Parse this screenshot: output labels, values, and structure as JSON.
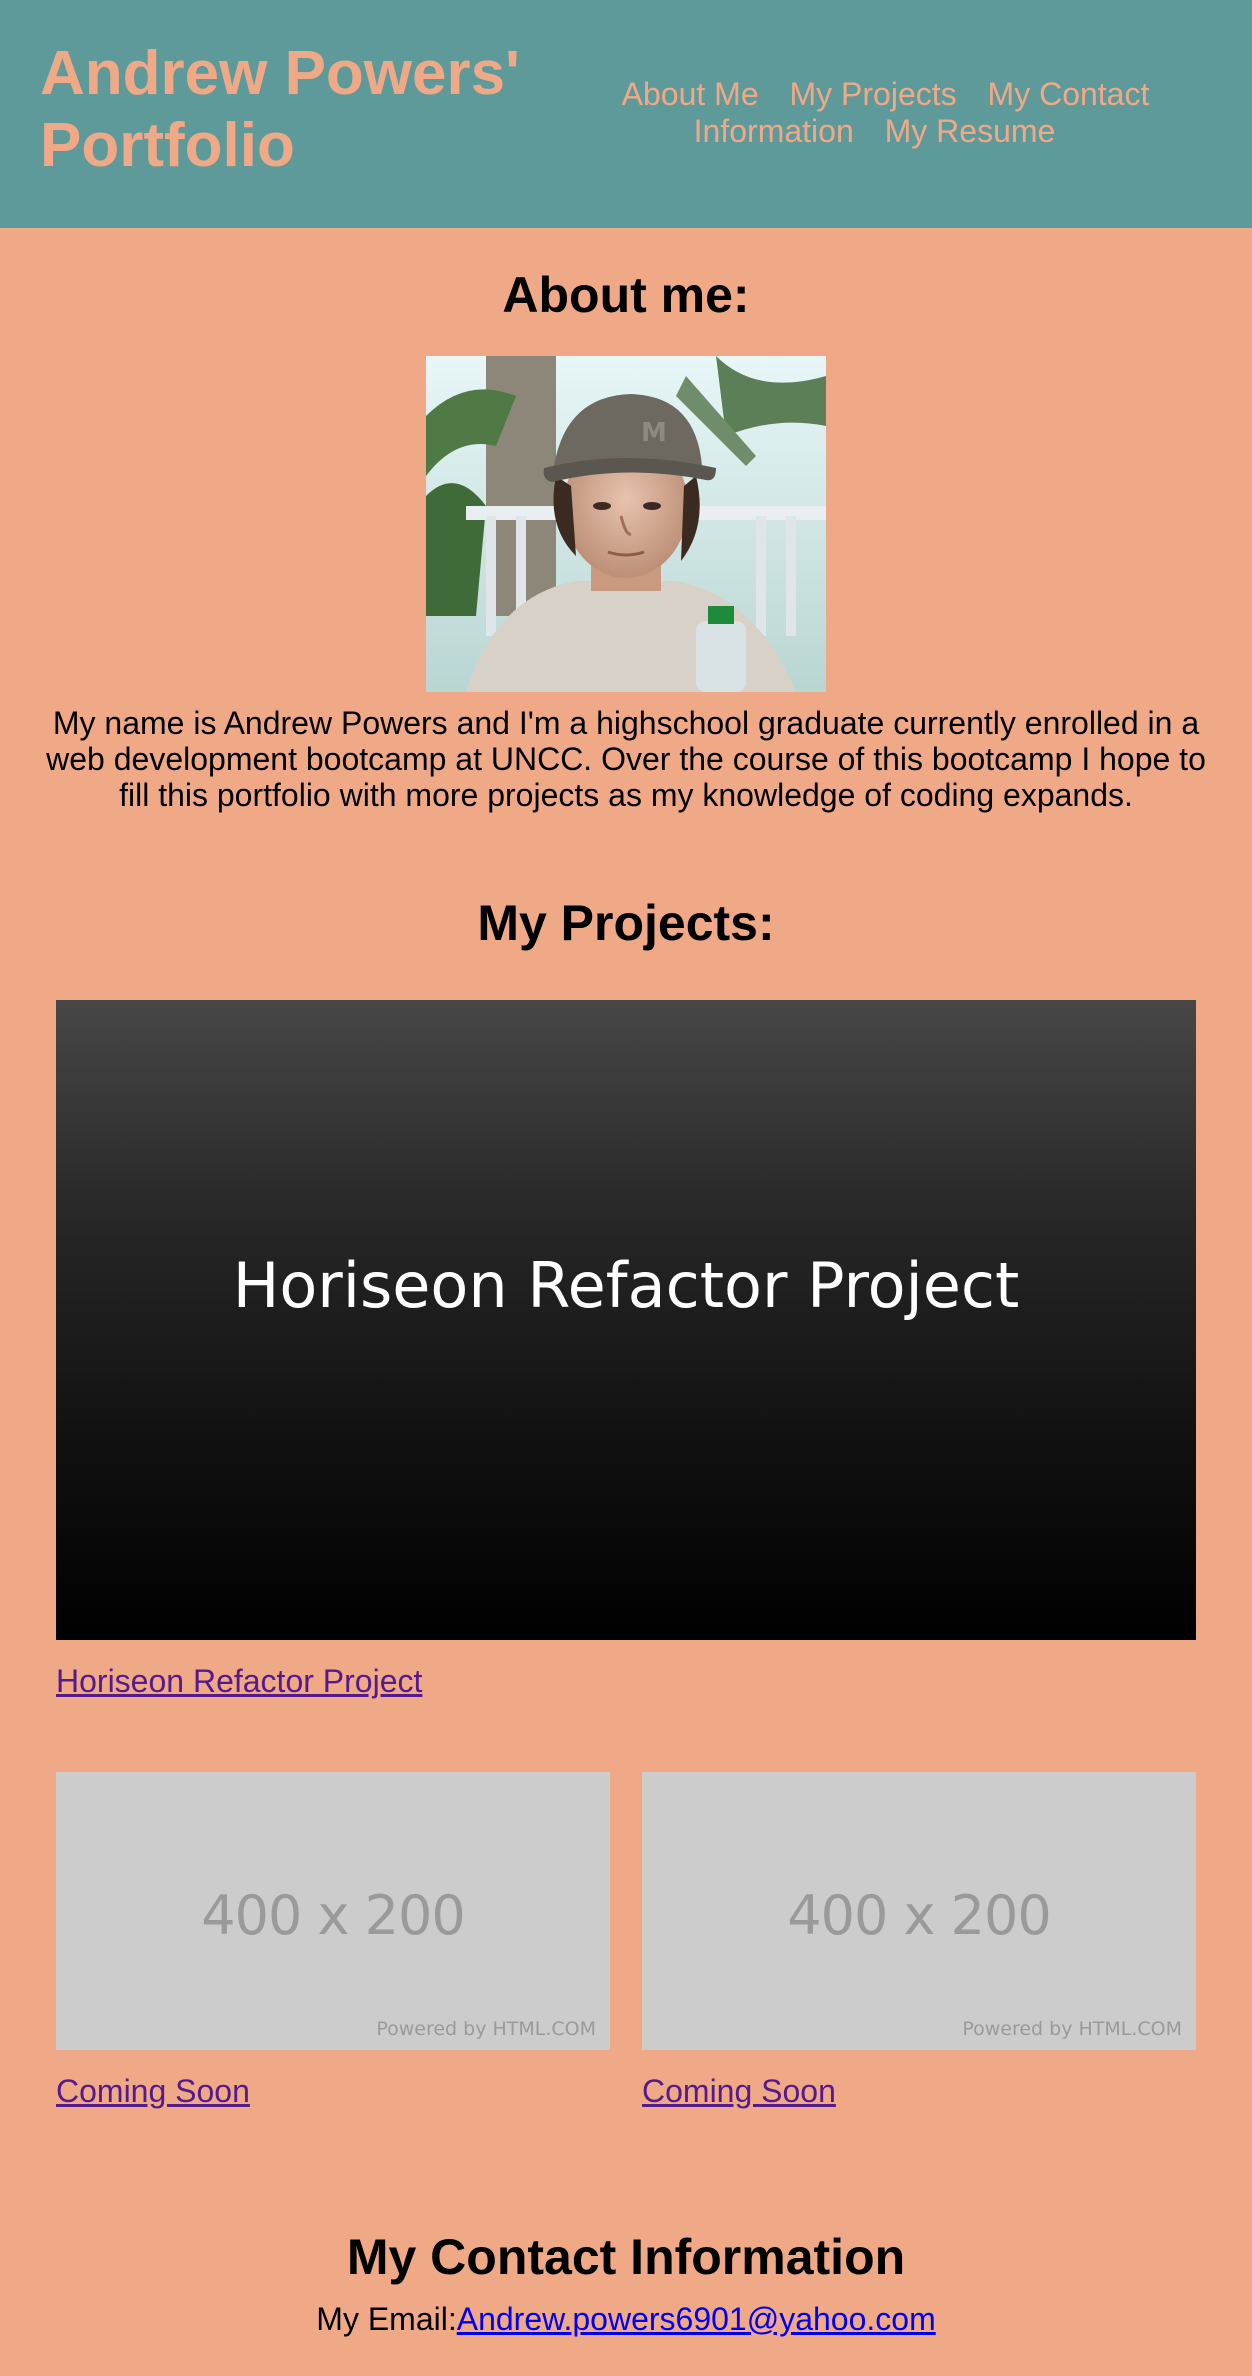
{
  "header": {
    "title": "Andrew Powers' Portfolio",
    "nav": [
      "About Me",
      "My Projects",
      "My Contact Information",
      "My Resume"
    ]
  },
  "about": {
    "heading": "About me:",
    "bio": "My name is Andrew Powers and I'm a highschool graduate currently enrolled in a web development bootcamp at UNCC. Over the course of this bootcamp I hope to fill this portfolio with more projects as my knowledge of coding expands."
  },
  "projects": {
    "heading": "My Projects:",
    "featured": {
      "image_text": "Horiseon Refactor Project",
      "link": "Horiseon Refactor Project"
    },
    "upcoming": [
      {
        "dims": "400 x 200",
        "powered": "Powered by HTML.COM",
        "link": "Coming Soon"
      },
      {
        "dims": "400 x 200",
        "powered": "Powered by HTML.COM",
        "link": "Coming Soon"
      }
    ]
  },
  "contact": {
    "heading": "My Contact Information",
    "email_label": "My Email:",
    "email": "Andrew.powers6901@yahoo.com"
  },
  "colors": {
    "page_background": "#f0a987",
    "header_background": "#5f9a9b",
    "header_text": "#f0a987",
    "visited_link": "#551a8b",
    "link": "#0000ee"
  }
}
